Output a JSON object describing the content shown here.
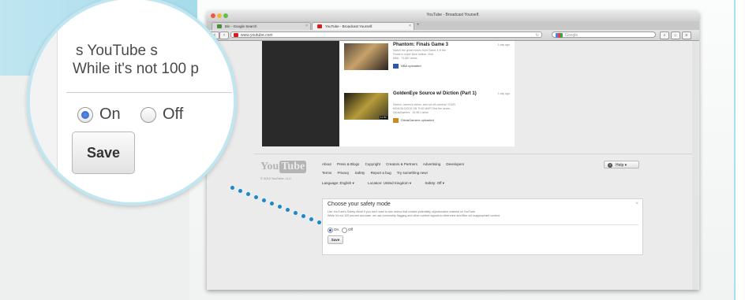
{
  "browser": {
    "window_title": "YouTube - Broadcast Yourself.",
    "tabs": [
      {
        "label": "Bin - Google Search",
        "active": false
      },
      {
        "label": "YouTube - Broadcast Yourself.",
        "active": true
      }
    ],
    "url": "www.youtube.com",
    "search_placeholder": "Google"
  },
  "videos": [
    {
      "title": "Phantom: Finals Game 3",
      "time": "1 day ago",
      "desc_lines": [
        "Watch the great moves from Game 3 of the",
        "Finals in super slow motion. Visit",
        "NBA · 73,687 views"
      ],
      "uploader": "NBA uploaded"
    },
    {
      "title": "GoldenEye Source w/ Diction (Part 1)",
      "time": "1 day ago",
      "desc_lines": [
        "Diction, James's online, and not off-camera! YOUR",
        "MOM BLOODS ON THIS MAP! Test the seven...",
        "DiictaGamers · 15,981 views"
      ],
      "uploader": "DiictaGamers uploaded",
      "duration": "11:52"
    }
  ],
  "footer": {
    "logo_you": "You",
    "logo_tube": "Tube",
    "copyright": "© 2012 YouTube, LLC",
    "links_row1": [
      "About",
      "Press & Blogs",
      "Copyright",
      "Creators & Partners",
      "Advertising",
      "Developers"
    ],
    "links_row2": [
      "Terms",
      "Privacy",
      "Safety",
      "Report a bug",
      "Try something new!"
    ],
    "links_row3": [
      "Language: English ▾",
      "Location: United Kingdom ▾",
      "Safety: Off ▾"
    ],
    "help_label": "Help ▾"
  },
  "safety_mode": {
    "heading": "Choose your safety mode",
    "desc_lines": [
      "Use YouTube's Safety Mode if you don't want to see videos that contain potentially objectionable material on YouTube.",
      "While it's not 100 percent accurate, we use community flagging and other content signals to determine and filter out inappropriate content."
    ],
    "option_on": "On",
    "option_off": "Off",
    "selected": "On",
    "save_label": "Save"
  },
  "magnifier": {
    "line1": "s YouTube s",
    "line2": "While it's not 100 p",
    "option_on": "On",
    "option_off": "Off",
    "save_label": "Save"
  },
  "colors": {
    "accent_teal": "#a9dff0",
    "connector_dots": "#1a88c9",
    "radio_selected": "#2a5fc4"
  }
}
